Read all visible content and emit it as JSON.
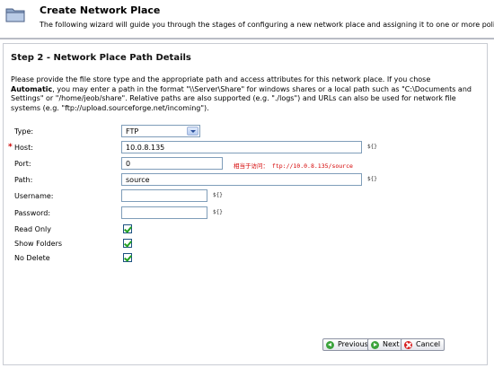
{
  "header": {
    "title": "Create Network Place",
    "subtitle": "The following wizard will guide you through the stages of configuring a new network place and assigning it to one or more policies."
  },
  "step": {
    "title": "Step 2 - Network Place Path Details",
    "desc_part1": "Please provide the file store type and the appropriate path and access attributes for this network place. If you chose",
    "desc_bold": "Automatic",
    "desc_part2": ", you may enter a path in the format \"\\\\Server\\Share\" for windows shares or a local path such as \"C:\\Documents and Settings\" or \"/home/jeob/share\". Relative paths are also supported (e.g. \"./logs\") and URLs can also be used for network file systems (e.g. \"ftp://upload.sourceforge.net/incoming\")."
  },
  "form": {
    "type_label": "Type:",
    "type_value": "FTP",
    "host_required": "*",
    "host_label": "Host:",
    "host_value": "10.0.8.135",
    "port_label": "Port:",
    "port_value": "0",
    "port_hint": "相当于访问： ftp://10.0.8.135/source",
    "path_label": "Path:",
    "path_value": "source",
    "username_label": "Username:",
    "username_value": "",
    "password_label": "Password:",
    "password_value": "",
    "readonly_label": "Read Only",
    "readonly_checked": true,
    "showfolders_label": "Show Folders",
    "showfolders_checked": true,
    "nodelete_label": "No Delete",
    "nodelete_checked": true,
    "token": "${}"
  },
  "buttons": {
    "previous": "Previous",
    "next": "Next",
    "cancel": "Cancel"
  },
  "colors": {
    "hint": "#d40000",
    "check": "#21a121"
  }
}
